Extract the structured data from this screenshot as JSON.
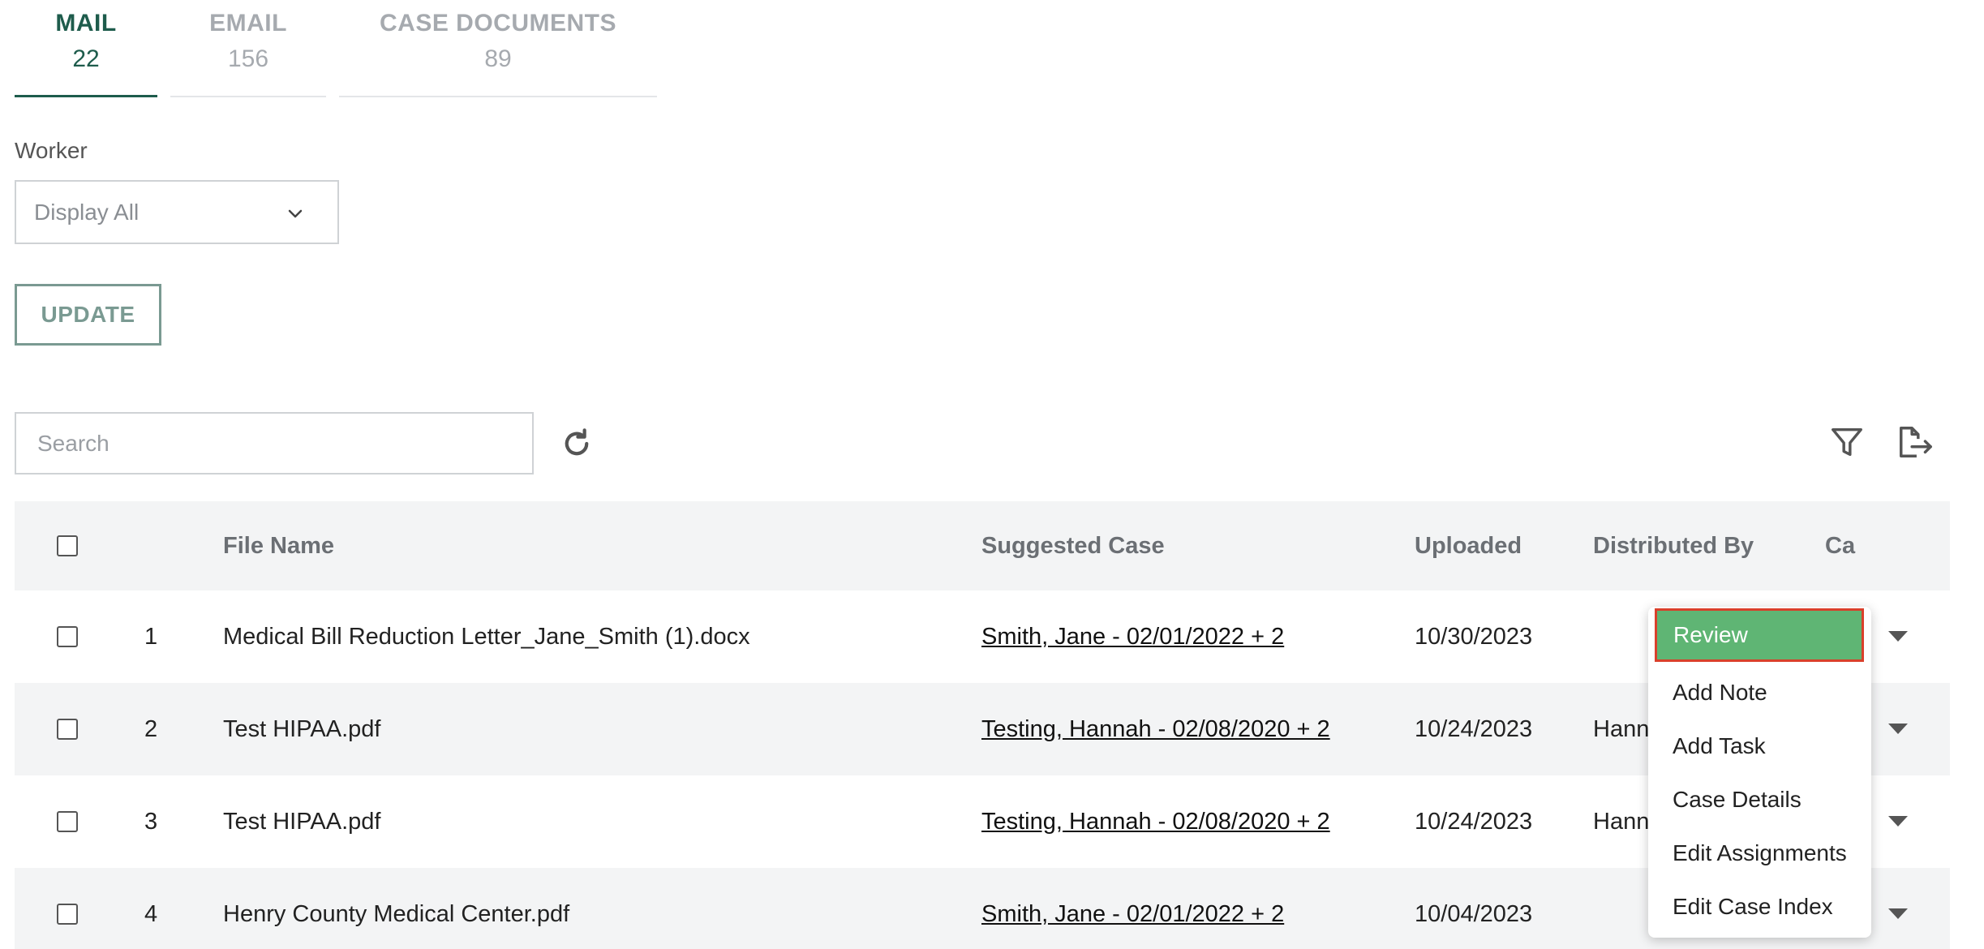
{
  "tabs": [
    {
      "label": "MAIL",
      "count": "22"
    },
    {
      "label": "EMAIL",
      "count": "156"
    },
    {
      "label": "CASE DOCUMENTS",
      "count": "89"
    }
  ],
  "worker": {
    "label": "Worker",
    "value": "Display All"
  },
  "update_label": "UPDATE",
  "search": {
    "placeholder": "Search"
  },
  "table": {
    "headers": {
      "file": "File Name",
      "case": "Suggested Case",
      "uploaded": "Uploaded",
      "distributed": "Distributed By",
      "cat": "Ca"
    },
    "rows": [
      {
        "num": "1",
        "file": "Medical Bill Reduction Letter_Jane_Smith (1).docx",
        "case": "Smith, Jane - 02/01/2022 + 2",
        "uploaded": "10/30/2023",
        "distributed": ""
      },
      {
        "num": "2",
        "file": "Test HIPAA.pdf",
        "case": "Testing, Hannah - 02/08/2020 + 2",
        "uploaded": "10/24/2023",
        "distributed": "Hann"
      },
      {
        "num": "3",
        "file": "Test HIPAA.pdf",
        "case": "Testing, Hannah - 02/08/2020 + 2",
        "uploaded": "10/24/2023",
        "distributed": "Hann"
      },
      {
        "num": "4",
        "file": "Henry County Medical Center.pdf",
        "case": "Smith, Jane - 02/01/2022 + 2",
        "uploaded": "10/04/2023",
        "distributed": ""
      }
    ]
  },
  "menu": {
    "items": [
      "Review",
      "Add Note",
      "Add Task",
      "Case Details",
      "Edit Assignments",
      "Edit Case Index"
    ]
  },
  "colors": {
    "accent": "#1e5c4c",
    "review_highlight": "#5fb574",
    "highlight_border": "#d9402b"
  }
}
